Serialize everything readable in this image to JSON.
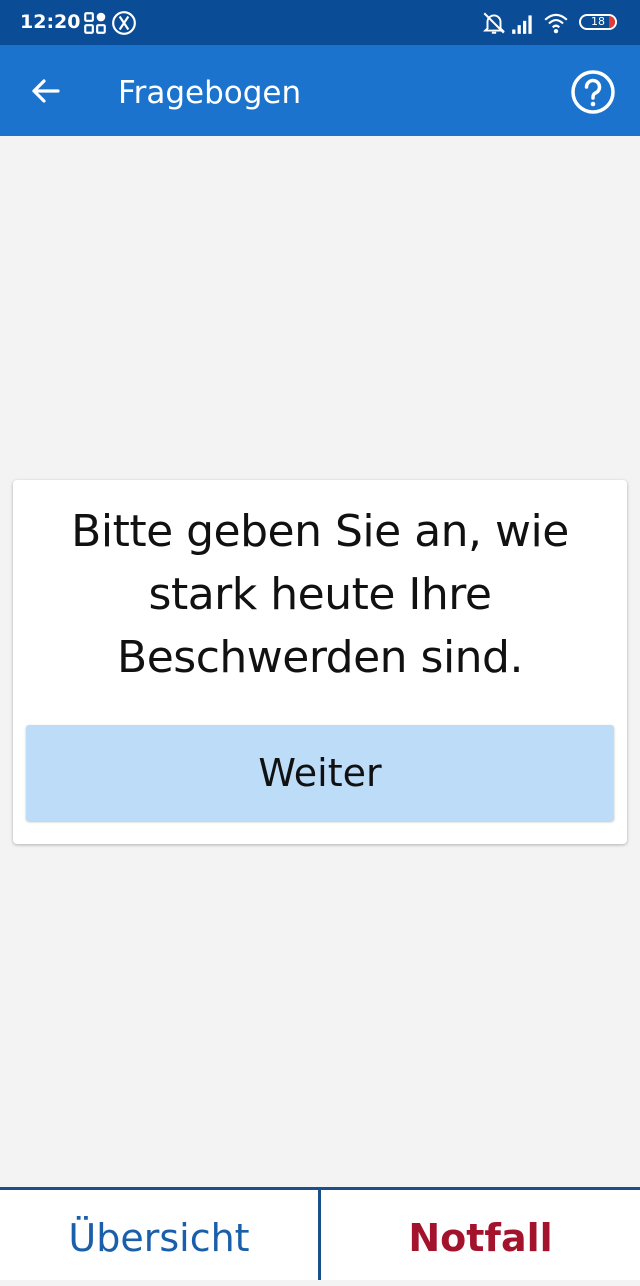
{
  "status_bar": {
    "time": "12:20",
    "battery_level": "18",
    "icons": [
      "grid-apps-icon",
      "x-circle-icon",
      "bell-off-icon",
      "signal-icon",
      "wifi-icon",
      "battery-icon"
    ]
  },
  "app_bar": {
    "title": "Fragebogen",
    "back_icon": "arrow-left-icon",
    "help_icon": "help-circle-icon"
  },
  "question": {
    "text": "Bitte geben Sie an, wie stark heute Ihre Beschwerden sind.",
    "next_label": "Weiter"
  },
  "bottom_nav": {
    "overview_label": "Übersicht",
    "emergency_label": "Notfall"
  },
  "colors": {
    "status_bar": "#0b4c97",
    "app_bar": "#1b73cd",
    "background": "#f3f3f3",
    "button": "#bcdcf8",
    "nav_overview": "#1a5fa9",
    "nav_emergency": "#a3132c",
    "battery_low": "#e53935"
  }
}
